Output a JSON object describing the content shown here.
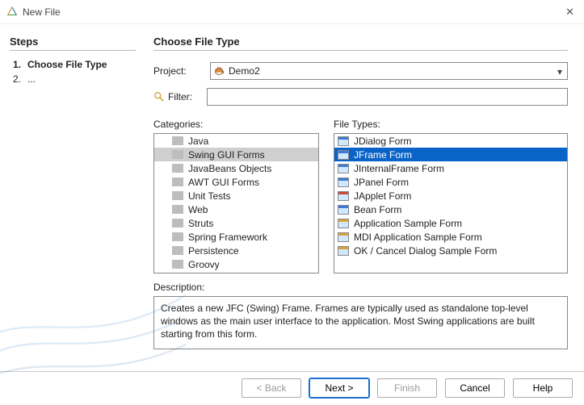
{
  "window": {
    "title": "New File"
  },
  "steps": {
    "heading": "Steps",
    "items": [
      {
        "num": "1.",
        "label": "Choose File Type",
        "active": true
      },
      {
        "num": "2.",
        "label": "...",
        "active": false
      }
    ]
  },
  "wizard_heading": "Choose File Type",
  "project": {
    "label": "Project:",
    "value": "Demo2"
  },
  "filter": {
    "label": "Filter:",
    "value": ""
  },
  "categories": {
    "label": "Categories:",
    "items": [
      {
        "label": "Java",
        "selected": false
      },
      {
        "label": "Swing GUI Forms",
        "selected": true
      },
      {
        "label": "JavaBeans Objects",
        "selected": false
      },
      {
        "label": "AWT GUI Forms",
        "selected": false
      },
      {
        "label": "Unit Tests",
        "selected": false
      },
      {
        "label": "Web",
        "selected": false
      },
      {
        "label": "Struts",
        "selected": false
      },
      {
        "label": "Spring Framework",
        "selected": false
      },
      {
        "label": "Persistence",
        "selected": false
      },
      {
        "label": "Groovy",
        "selected": false
      }
    ]
  },
  "file_types": {
    "label": "File Types:",
    "items": [
      {
        "label": "JDialog Form",
        "selected": false,
        "icon": "form"
      },
      {
        "label": "JFrame Form",
        "selected": true,
        "icon": "form"
      },
      {
        "label": "JInternalFrame Form",
        "selected": false,
        "icon": "form"
      },
      {
        "label": "JPanel Form",
        "selected": false,
        "icon": "form"
      },
      {
        "label": "JApplet Form",
        "selected": false,
        "icon": "form-red"
      },
      {
        "label": "Bean Form",
        "selected": false,
        "icon": "form"
      },
      {
        "label": "Application Sample Form",
        "selected": false,
        "icon": "form-yellow"
      },
      {
        "label": "MDI Application Sample Form",
        "selected": false,
        "icon": "form-yellow"
      },
      {
        "label": "OK / Cancel Dialog Sample Form",
        "selected": false,
        "icon": "form-yellow"
      }
    ]
  },
  "description": {
    "label": "Description:",
    "text": "Creates a new JFC (Swing) Frame. Frames are typically used as standalone top-level windows as the main user interface to the application. Most Swing applications are built starting from this form."
  },
  "buttons": {
    "back": "< Back",
    "next": "Next >",
    "finish": "Finish",
    "cancel": "Cancel",
    "help": "Help"
  }
}
